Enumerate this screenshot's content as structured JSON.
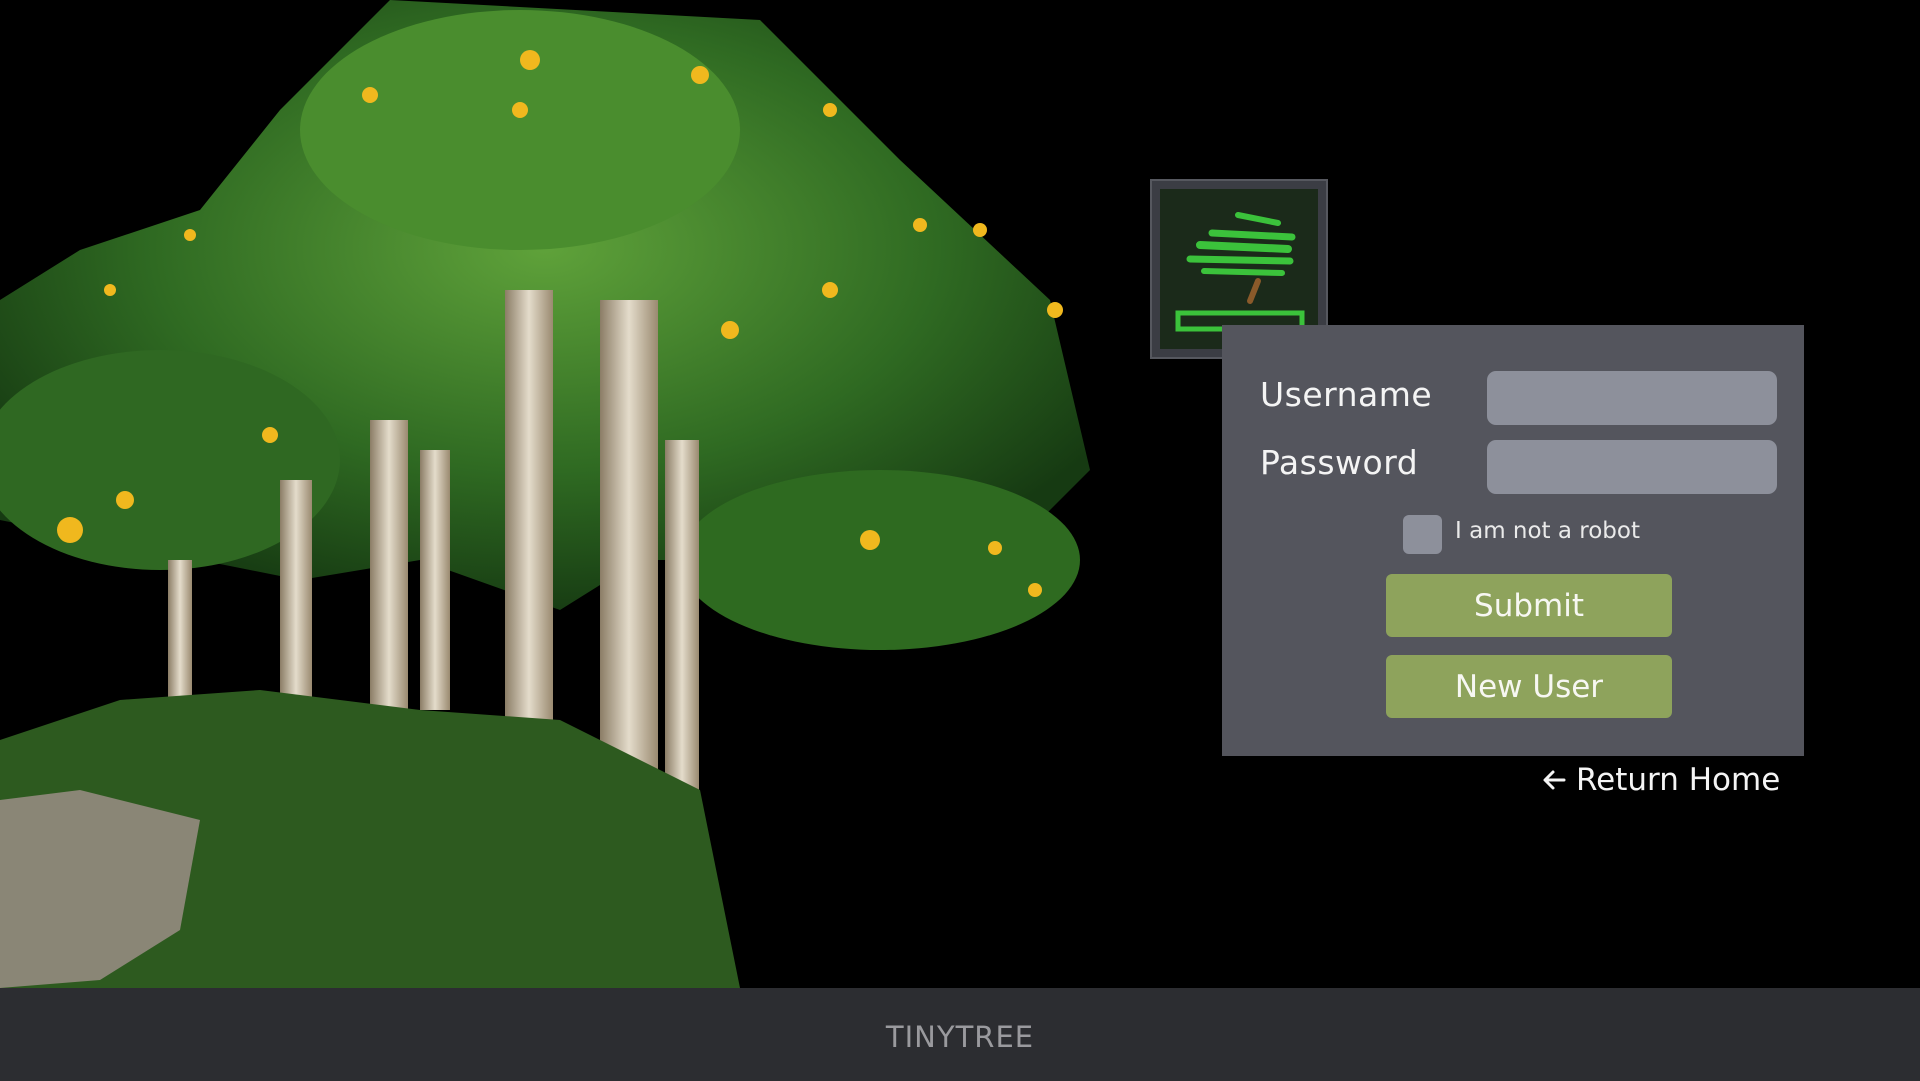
{
  "brand": {
    "logo_icon": "bonsai-logo-icon",
    "accent": "#8ea35c"
  },
  "login": {
    "username_label": "Username",
    "username_value": "",
    "password_label": "Password",
    "password_value": "",
    "robot_label": "I am not a robot",
    "submit_label": "Submit",
    "new_user_label": "New User"
  },
  "nav": {
    "return_icon": "arrow-left-icon",
    "return_label": "Return Home"
  },
  "footer": {
    "title": "TINYTREE"
  }
}
